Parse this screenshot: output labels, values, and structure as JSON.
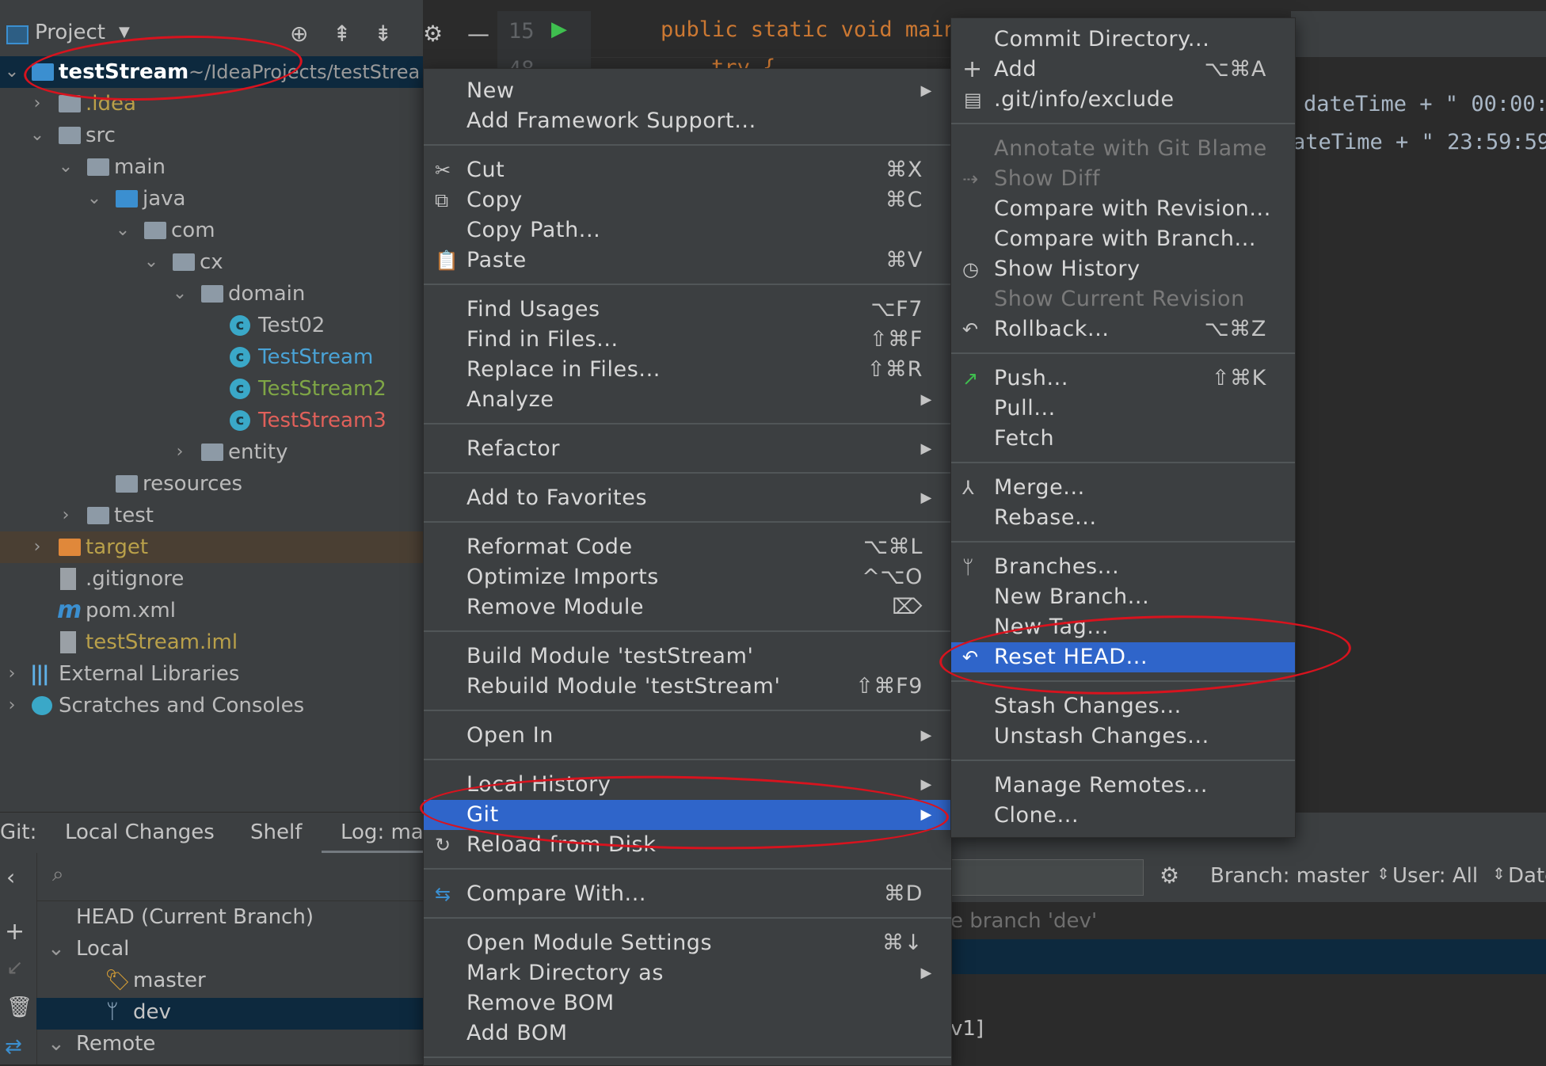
{
  "project": {
    "header": "Project",
    "tree": [
      {
        "label": "testStream",
        "path": "~/IdeaProjects/testStrea"
      },
      {
        "label": ".idea"
      },
      {
        "label": "src"
      },
      {
        "label": "main"
      },
      {
        "label": "java"
      },
      {
        "label": "com"
      },
      {
        "label": "cx"
      },
      {
        "label": "domain"
      },
      {
        "label": "Test02"
      },
      {
        "label": "TestStream"
      },
      {
        "label": "TestStream2"
      },
      {
        "label": "TestStream3"
      },
      {
        "label": "entity"
      },
      {
        "label": "resources"
      },
      {
        "label": "test"
      },
      {
        "label": "target"
      },
      {
        "label": ".gitignore"
      },
      {
        "label": "pom.xml"
      },
      {
        "label": "testStream.iml"
      },
      {
        "label": "External Libraries"
      },
      {
        "label": "Scratches and Consoles"
      }
    ]
  },
  "editor": {
    "line1": "15",
    "line2": "48",
    "code1": "public static void main",
    "code2": "try {",
    "right1": "dateTime + \" 00:00:",
    "right2": "ateTime + \" 23:59:59"
  },
  "git": {
    "tabs": [
      "Git:",
      "Local Changes",
      "Shelf",
      "Log: ma"
    ],
    "tree": [
      "HEAD (Current Branch)",
      "Local",
      "master",
      "dev",
      "Remote"
    ],
    "branch_filter": "Branch: master",
    "user_filter": "User: All",
    "date_filter": "Date",
    "log_text": "e branch 'dev'",
    "log_text2": "v1]"
  },
  "context_menu": {
    "items": [
      {
        "label": "New",
        "shortcut": "",
        "submenu": true
      },
      {
        "label": "Add Framework Support...",
        "shortcut": ""
      },
      {
        "label": "Cut",
        "shortcut": "⌘X",
        "icon": "scissors-icon"
      },
      {
        "label": "Copy",
        "shortcut": "⌘C",
        "icon": "copy-icon"
      },
      {
        "label": "Copy Path...",
        "shortcut": ""
      },
      {
        "label": "Paste",
        "shortcut": "⌘V",
        "icon": "paste-icon"
      },
      {
        "label": "Find Usages",
        "shortcut": "⌥F7"
      },
      {
        "label": "Find in Files...",
        "shortcut": "⇧⌘F"
      },
      {
        "label": "Replace in Files...",
        "shortcut": "⇧⌘R"
      },
      {
        "label": "Analyze",
        "shortcut": "",
        "submenu": true
      },
      {
        "label": "Refactor",
        "shortcut": "",
        "submenu": true
      },
      {
        "label": "Add to Favorites",
        "shortcut": "",
        "submenu": true
      },
      {
        "label": "Reformat Code",
        "shortcut": "⌥⌘L"
      },
      {
        "label": "Optimize Imports",
        "shortcut": "^⌥O"
      },
      {
        "label": "Remove Module",
        "shortcut": "⌦"
      },
      {
        "label": "Build Module 'testStream'",
        "shortcut": ""
      },
      {
        "label": "Rebuild Module 'testStream'",
        "shortcut": "⇧⌘F9"
      },
      {
        "label": "Open In",
        "shortcut": "",
        "submenu": true
      },
      {
        "label": "Local History",
        "shortcut": "",
        "submenu": true
      },
      {
        "label": "Git",
        "shortcut": "",
        "submenu": true
      },
      {
        "label": "Reload from Disk",
        "shortcut": "",
        "icon": "reload-icon"
      },
      {
        "label": "Compare With...",
        "shortcut": "⌘D",
        "icon": "compare-icon"
      },
      {
        "label": "Open Module Settings",
        "shortcut": "⌘↓"
      },
      {
        "label": "Mark Directory as",
        "shortcut": "",
        "submenu": true
      },
      {
        "label": "Remove BOM",
        "shortcut": ""
      },
      {
        "label": "Add BOM",
        "shortcut": ""
      }
    ]
  },
  "git_submenu": {
    "items": [
      {
        "label": "Commit Directory...",
        "shortcut": ""
      },
      {
        "label": "Add",
        "shortcut": "⌥⌘A",
        "icon": "plus-icon"
      },
      {
        "label": ".git/info/exclude",
        "shortcut": "",
        "icon": "git-file-icon"
      },
      {
        "label": "Annotate with Git Blame",
        "shortcut": "",
        "disabled": true
      },
      {
        "label": "Show Diff",
        "shortcut": "",
        "disabled": true,
        "icon": "diff-icon"
      },
      {
        "label": "Compare with Revision...",
        "shortcut": ""
      },
      {
        "label": "Compare with Branch...",
        "shortcut": ""
      },
      {
        "label": "Show History",
        "shortcut": "",
        "icon": "clock-icon"
      },
      {
        "label": "Show Current Revision",
        "shortcut": "",
        "disabled": true
      },
      {
        "label": "Rollback...",
        "shortcut": "⌥⌘Z",
        "icon": "undo-icon"
      },
      {
        "label": "Push...",
        "shortcut": "⇧⌘K",
        "icon": "push-arrow-icon"
      },
      {
        "label": "Pull...",
        "shortcut": ""
      },
      {
        "label": "Fetch",
        "shortcut": ""
      },
      {
        "label": "Merge...",
        "shortcut": "",
        "icon": "merge-icon"
      },
      {
        "label": "Rebase...",
        "shortcut": ""
      },
      {
        "label": "Branches...",
        "shortcut": "",
        "icon": "branch-icon"
      },
      {
        "label": "New Branch...",
        "shortcut": ""
      },
      {
        "label": "New Tag...",
        "shortcut": ""
      },
      {
        "label": "Reset HEAD...",
        "shortcut": "",
        "icon": "reset-icon"
      },
      {
        "label": "Stash Changes...",
        "shortcut": ""
      },
      {
        "label": "Unstash Changes...",
        "shortcut": ""
      },
      {
        "label": "Manage Remotes...",
        "shortcut": ""
      },
      {
        "label": "Clone...",
        "shortcut": ""
      }
    ]
  },
  "colors": {
    "accent": "#2f65ca",
    "annotation": "#d8131e",
    "test_stream": "#4aa3d6",
    "test_stream2": "#7fa646",
    "test_stream3": "#e0605a",
    "target": "#b9a04a"
  }
}
